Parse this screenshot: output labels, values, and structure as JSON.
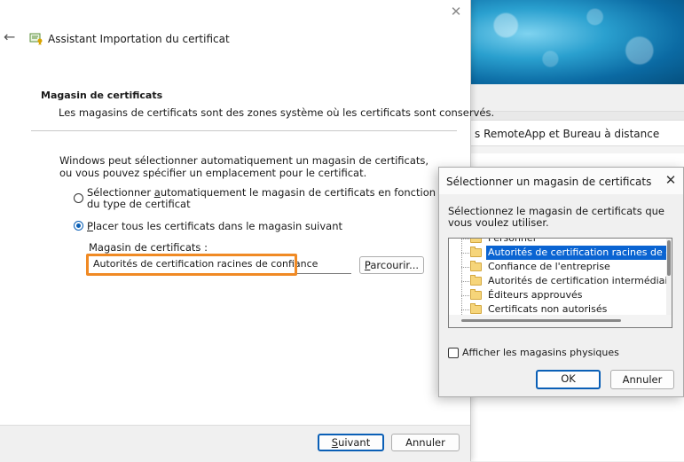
{
  "wizard": {
    "title": "Assistant Importation du certificat",
    "section_title": "Magasin de certificats",
    "section_description": "Les magasins de certificats sont des zones système où les certificats sont conservés.",
    "intro": "Windows peut sélectionner automatiquement un magasin de certificats, ou vous pouvez spécifier un emplacement pour le certificat.",
    "option_auto_pre": "Sélectionner ",
    "option_auto_key": "a",
    "option_auto_post": "utomatiquement le magasin de certificats en fonction du type de certificat",
    "option_manual_key": "P",
    "option_manual_post": "lacer tous les certificats dans le magasin suivant",
    "selected_option": "manual",
    "store_label": "Magasin de certificats :",
    "store_value": "Autorités de certification racines de confiance",
    "browse_key": "P",
    "browse_post": "arcourir...",
    "next_key": "S",
    "next_post": "uivant",
    "cancel_label": "Annuler",
    "highlight_color": "#f08a24"
  },
  "background_window": {
    "row_text": "s RemoteApp et Bureau à distance"
  },
  "select_dialog": {
    "title": "Sélectionner un magasin de certificats",
    "description": "Sélectionnez le magasin de certificats que vous voulez utiliser.",
    "stores": [
      {
        "label": "Personnel",
        "selected": false
      },
      {
        "label": "Autorités de certification racines de conf",
        "selected": true
      },
      {
        "label": "Confiance de l'entreprise",
        "selected": false
      },
      {
        "label": "Autorités de certification intermédiaires",
        "selected": false
      },
      {
        "label": "Éditeurs approuvés",
        "selected": false
      },
      {
        "label": "Certificats non autorisés",
        "selected": false
      }
    ],
    "show_physical_label": "Afficher les magasins physiques",
    "show_physical_checked": false,
    "ok_label": "OK",
    "cancel_label": "Annuler"
  },
  "accent_color": "#0a5fb6",
  "selection_color": "#0a64d2"
}
